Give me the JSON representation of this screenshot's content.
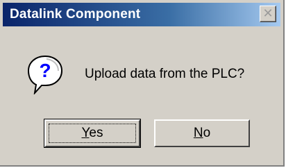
{
  "window": {
    "title": "Datalink Component",
    "close_icon": "close-icon"
  },
  "dialog": {
    "icon": "question-icon",
    "message": "Upload data from the PLC?"
  },
  "buttons": {
    "yes": {
      "accel": "Y",
      "rest": "es"
    },
    "no": {
      "accel": "N",
      "rest": "o"
    }
  },
  "colors": {
    "titlebar_start": "#0a246a",
    "titlebar_end": "#a6caf0",
    "face": "#d4d0c8",
    "icon_blue": "#0000ff"
  }
}
